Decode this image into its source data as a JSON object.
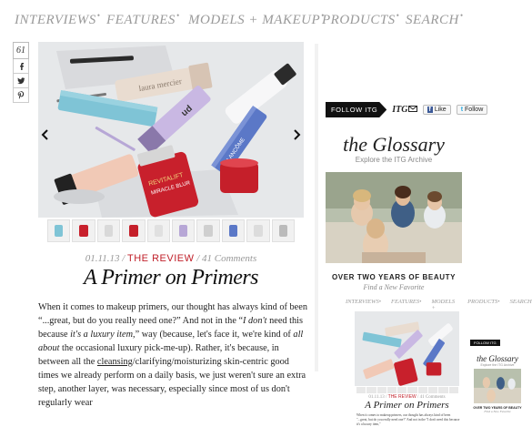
{
  "nav": {
    "items": [
      "INTERVIEWS",
      "FEATURES",
      "MODELS + MAKEUP",
      "PRODUCTS",
      "SEARCH"
    ],
    "dot": "•"
  },
  "share": {
    "count": "61"
  },
  "post": {
    "date": "01.11.13",
    "separator": "/",
    "category": "THE REVIEW",
    "comments": "41 Comments",
    "title": "A Primer on Primers",
    "body_parts": [
      "When it comes to makeup primers, our thought has always kind of been “...great, but do you really need one?” And not in the “",
      "I don't",
      " need this because ",
      "it's a luxury item,",
      "” way (because, let's face it, we're kind of ",
      "all about",
      " the occasional luxury pick-me-up). Rather, it's because, in between all the ",
      "cleansing",
      "/clarifying/moisturizing skin-centric good times we already perform on a daily basis, we just weren't sure an extra step, another layer, was necessary, especially since most of us don't regularly wear"
    ]
  },
  "hero_products": {
    "laura_mercier": "laura mercier",
    "lancome": "LANCÔME",
    "revitalift": "REVITALIFT",
    "miracle_blur": "MIRACLE BLUR",
    "ud": "ud"
  },
  "sidebar": {
    "follow": "FOLLOW ITG",
    "itg_mini": "ITG",
    "facebook_like": "Like",
    "twitter_follow": "Follow",
    "glossary_title": "the Glossary",
    "glossary_subtitle": "Explore the ITG Archive",
    "years": "OVER TWO YEARS OF BEAUTY",
    "new_favorite": "Find a New Favorite"
  },
  "mini": {
    "nav": [
      "INTERVIEWS•",
      "FEATURES•",
      "MODELS + MAKEUP•",
      "PRODUCTS•",
      "SEARCH•"
    ],
    "date": "01.11.13",
    "category": "THE REVIEW",
    "comments": "41 Comments",
    "title": "A Primer on Primers",
    "body": "When it comes to makeup primers, our thought has always kind of been \"...great, but do you really need one?\" And not in the \"I don't need this because it's a luxury item,\"",
    "follow": "FOLLOW ITG",
    "glossary_title": "the Glossary",
    "glossary_subtitle": "Explore the ITG Archive",
    "years": "OVER TWO YEARS OF BEAUTY",
    "new_favorite": "Find a New Favorite"
  },
  "colors": {
    "accent_red": "#c0202a",
    "nav_gray": "#9a9a9a",
    "facebook_blue": "#3b5998",
    "twitter_blue": "#2aa9e0"
  }
}
